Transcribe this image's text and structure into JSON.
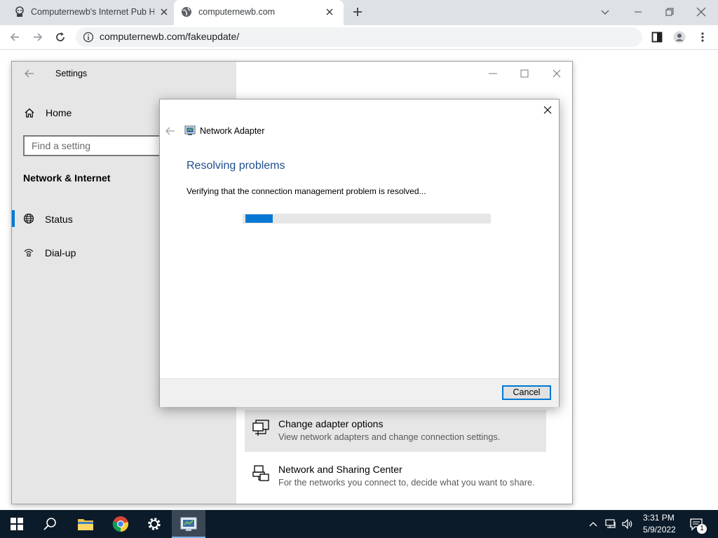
{
  "browser": {
    "tabs": [
      {
        "title": "Computernewb's Internet Pub Ho",
        "favicon": "pub-logo-icon"
      },
      {
        "title": "computernewb.com",
        "favicon": "globe-icon",
        "active": true
      }
    ],
    "url": "computernewb.com/fakeupdate/"
  },
  "settings": {
    "window_title": "Settings",
    "home_label": "Home",
    "search_placeholder": "Find a setting",
    "section_title": "Network & Internet",
    "nav": [
      {
        "label": "Status",
        "icon": "globe-icon",
        "selected": true
      },
      {
        "label": "Dial-up",
        "icon": "dialup-icon"
      }
    ],
    "cards": [
      {
        "title": "Change adapter options",
        "desc": "View network adapters and change connection settings.",
        "icon": "adapter-icon"
      },
      {
        "title": "Network and Sharing Center",
        "desc": "For the networks you connect to, decide what you want to share.",
        "icon": "sharing-icon"
      }
    ]
  },
  "dialog": {
    "title": "Network Adapter",
    "heading": "Resolving problems",
    "status": "Verifying that the connection management problem is resolved...",
    "progress": 0.11,
    "cancel_label": "Cancel"
  },
  "taskbar": {
    "apps": [
      "start",
      "search",
      "file-explorer",
      "chrome",
      "settings",
      "troubleshooter"
    ],
    "time": "3:31 PM",
    "date": "5/9/2022",
    "notification_count": "1"
  },
  "colors": {
    "accent": "#0078d4",
    "heading_blue": "#1e4e8c",
    "taskbar": "#0c1b2a"
  }
}
